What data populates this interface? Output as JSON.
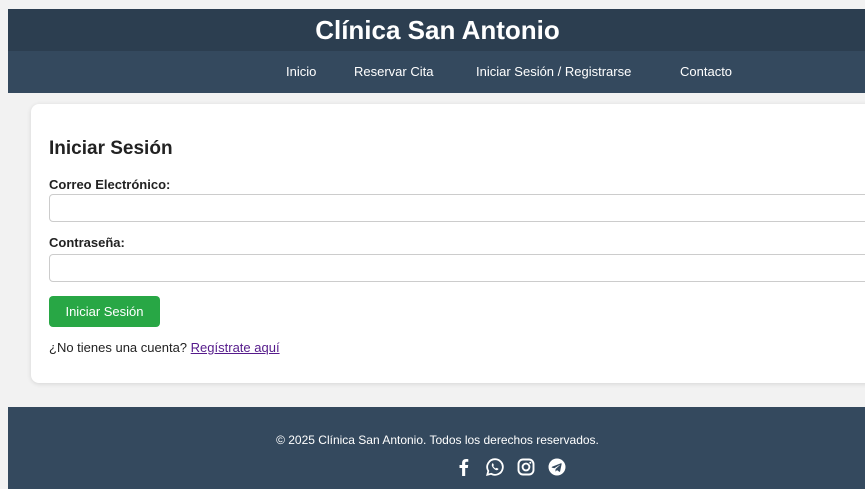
{
  "header": {
    "title": "Clínica San Antonio",
    "nav": [
      {
        "label": "Inicio"
      },
      {
        "label": "Reservar Cita"
      },
      {
        "label": "Iniciar Sesión / Registrarse"
      },
      {
        "label": "Contacto"
      }
    ]
  },
  "login": {
    "heading": "Iniciar Sesión",
    "email_label": "Correo Electrónico:",
    "email_value": "",
    "password_label": "Contraseña:",
    "password_value": "",
    "submit_label": "Iniciar Sesión",
    "register_prompt": "¿No tienes una cuenta?",
    "register_link": "Regístrate aquí"
  },
  "footer": {
    "copyright": "© 2025 Clínica San Antonio. Todos los derechos reservados.",
    "social_icons": [
      "facebook-icon",
      "whatsapp-icon",
      "instagram-icon",
      "telegram-icon"
    ]
  },
  "colors": {
    "header_top": "#2c3e50",
    "nav_bar": "#34495e",
    "button": "#28a745",
    "link": "#551a8b",
    "page_bg": "#f2f2f2"
  }
}
